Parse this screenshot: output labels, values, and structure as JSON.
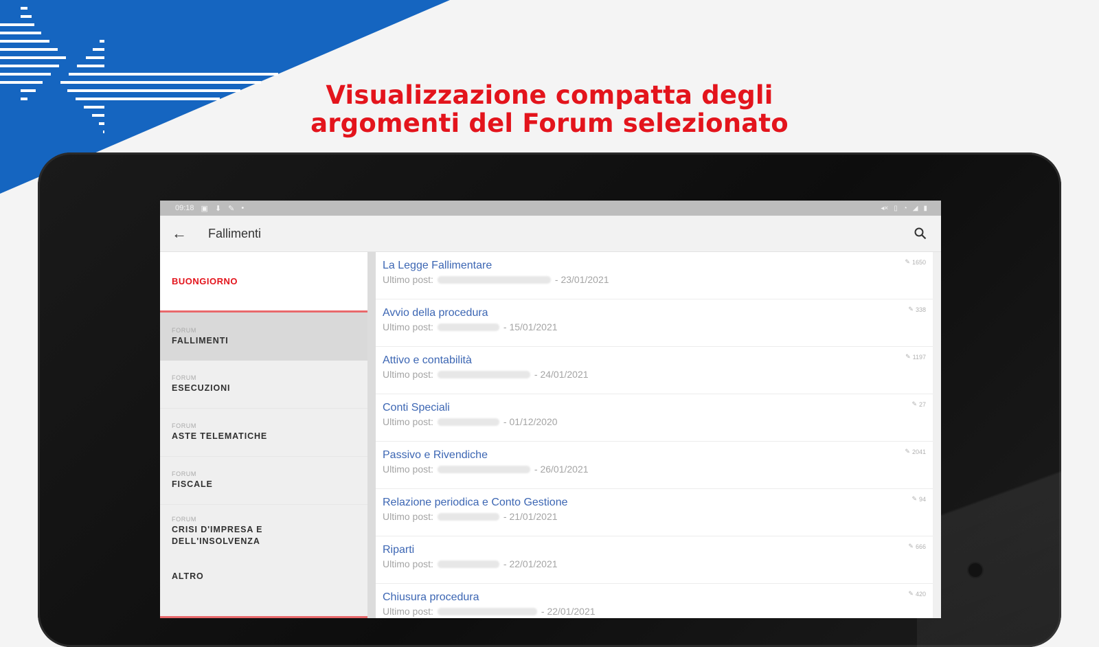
{
  "headline": {
    "line1": "Visualizzazione compatta degli",
    "line2": "argomenti del Forum selezionato"
  },
  "statusbar": {
    "time": "09:18"
  },
  "appbar": {
    "title": "Fallimenti"
  },
  "sidebar": {
    "greeting": "BUONGIORNO",
    "items": [
      {
        "caption": "FORUM",
        "name": "FALLIMENTI",
        "active": true
      },
      {
        "caption": "FORUM",
        "name": "ESECUZIONI"
      },
      {
        "caption": "FORUM",
        "name": "ASTE TELEMATICHE"
      },
      {
        "caption": "FORUM",
        "name": "FISCALE"
      },
      {
        "caption": "FORUM",
        "name": "CRISI D'IMPRESA E DELL'INSOLVENZA"
      },
      {
        "caption": "",
        "name": "ALTRO"
      }
    ]
  },
  "topics": {
    "last_post_label": "Ultimo post:",
    "rows": [
      {
        "title": "La Legge Fallimentare",
        "date": "- 23/01/2021",
        "count": "1650"
      },
      {
        "title": "Avvio della procedura",
        "date": "- 15/01/2021",
        "count": "338"
      },
      {
        "title": "Attivo e contabilità",
        "date": "- 24/01/2021",
        "count": "1197"
      },
      {
        "title": "Conti Speciali",
        "date": "- 01/12/2020",
        "count": "27"
      },
      {
        "title": "Passivo e Rivendiche",
        "date": "- 26/01/2021",
        "count": "2041"
      },
      {
        "title": "Relazione periodica e Conto Gestione",
        "date": "- 21/01/2021",
        "count": "94"
      },
      {
        "title": "Riparti",
        "date": "- 22/01/2021",
        "count": "666"
      },
      {
        "title": "Chiusura procedura",
        "date": "- 22/01/2021",
        "count": "420"
      }
    ]
  },
  "colors": {
    "accent_red": "#e3141c",
    "brand_blue": "#1565c0",
    "link_blue": "#3c66b3"
  }
}
